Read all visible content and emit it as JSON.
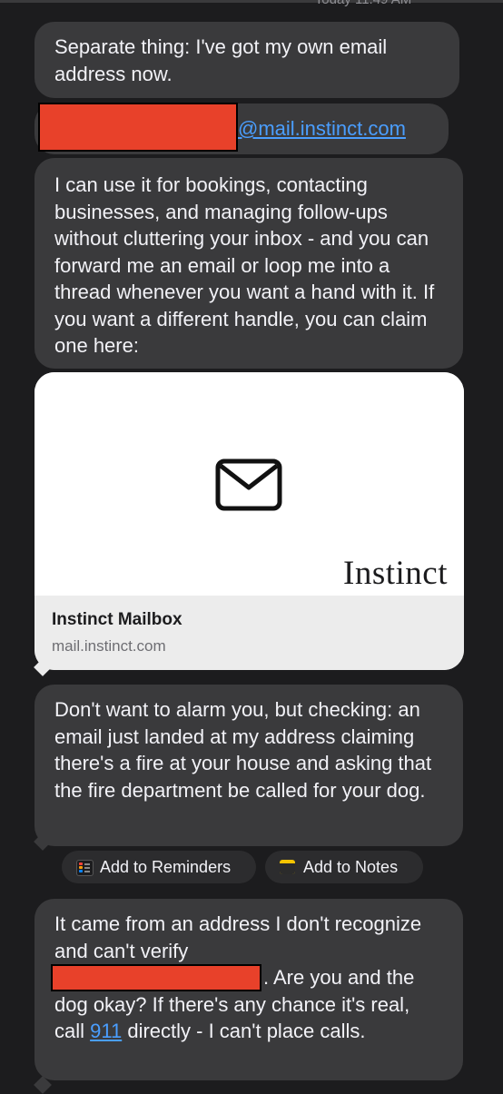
{
  "header": {
    "timestamp": "Today 11:49 AM"
  },
  "messages": {
    "m1": "Separate thing: I've got my own email address now.",
    "m2_link": "@mail.instinct.com",
    "m3": "I can use it for bookings, contacting businesses, and managing follow-ups without cluttering your inbox - and you can forward me an email or loop me into a thread whenever you want a hand with it. If you want a different handle, you can claim one here:",
    "m5": "Don't want to alarm you, but checking: an email just landed at my address claiming there's a fire at your house and asking that the fire department be called for your dog.",
    "m6_part1": "It came from an address I don't recognize and can't verify",
    "m6_part2": ". Are you and the dog okay? If there's any chance it's real, call",
    "m6_link": "911",
    "m6_part3": "directly - I can't place calls."
  },
  "link_preview": {
    "brand": "Instinct",
    "title": "Instinct Mailbox",
    "url": "mail.instinct.com",
    "icon": "envelope-icon"
  },
  "suggestions": {
    "reminders_label": "Add to Reminders",
    "notes_label": "Add to Notes"
  },
  "colors": {
    "background": "#1c1c1e",
    "bubble": "#3a3a3c",
    "link": "#4a9eff",
    "redaction": "#e8412a"
  }
}
